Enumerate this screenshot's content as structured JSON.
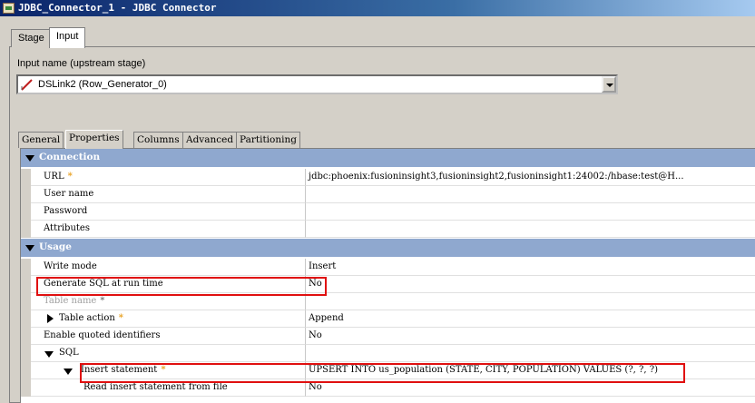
{
  "window": {
    "title": "JDBC_Connector_1 - JDBC Connector"
  },
  "outer_tabs": [
    {
      "label": "Stage"
    },
    {
      "label": "Input"
    }
  ],
  "input_name": {
    "label": "Input name (upstream stage)",
    "selected": "DSLink2 (Row_Generator_0)"
  },
  "inner_tabs": [
    {
      "label": "General"
    },
    {
      "label": "Properties"
    },
    {
      "label": "Columns"
    },
    {
      "label": "Advanced"
    },
    {
      "label": "Partitioning"
    }
  ],
  "groups": {
    "connection": "Connection",
    "usage": "Usage"
  },
  "properties": {
    "url": {
      "name": "URL",
      "value": "jdbc:phoenix:fusioninsight3,fusioninsight2,fusioninsight1:24002:/hbase:test@H..."
    },
    "user_name": {
      "name": "User name",
      "value": ""
    },
    "password": {
      "name": "Password",
      "value": ""
    },
    "attributes": {
      "name": "Attributes",
      "value": ""
    },
    "write_mode": {
      "name": "Write mode",
      "value": "Insert"
    },
    "generate_sql": {
      "name": "Generate SQL at run time",
      "value": "No"
    },
    "table_name": {
      "name": "Table name",
      "value": ""
    },
    "table_action": {
      "name": "Table action",
      "value": "Append"
    },
    "quoted_ids": {
      "name": "Enable quoted identifiers",
      "value": "No"
    },
    "sql": {
      "name": "SQL",
      "value": ""
    },
    "insert_statement": {
      "name": "Insert statement",
      "value": "UPSERT INTO us_population (STATE, CITY, POPULATION) VALUES (?, ?, ?)"
    },
    "read_from_file": {
      "name": "Read insert statement from file",
      "value": "No"
    }
  },
  "required_marker": "*",
  "colors": {
    "group_header": "#8fa8cf",
    "highlight": "#e01010",
    "required": "#e8a020"
  }
}
